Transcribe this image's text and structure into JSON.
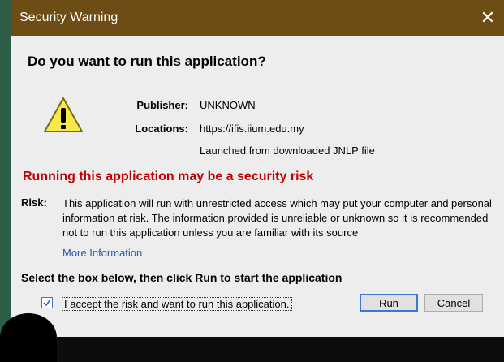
{
  "window": {
    "title": "Security Warning",
    "close_glyph": "✕"
  },
  "dialog": {
    "heading": "Do you want to run this application?",
    "warning_icon": "warning-icon",
    "publisher_label": "Publisher:",
    "publisher_value": "UNKNOWN",
    "locations_label": "Locations:",
    "location_value": "https://ifis.iium.edu.my",
    "location_note": "Launched from downloaded JNLP file",
    "risk_heading": "Running this application may be a security risk",
    "risk_label": "Risk:",
    "risk_text": "This application will run with unrestricted access which may put your computer and personal information at risk. The information provided is unreliable or unknown so it is recommended not to run this application unless you are familiar with its source",
    "more_info": "More Information",
    "select_heading": "Select the box below, then click Run to start the application",
    "accept_label": "I accept the risk and want to run this application.",
    "accept_checked": true,
    "run_label": "Run",
    "cancel_label": "Cancel"
  },
  "colors": {
    "titlebar": "#6d4d15",
    "risk_red": "#c00000",
    "link_blue": "#2d57a7",
    "dialog_bg": "#ededed"
  }
}
